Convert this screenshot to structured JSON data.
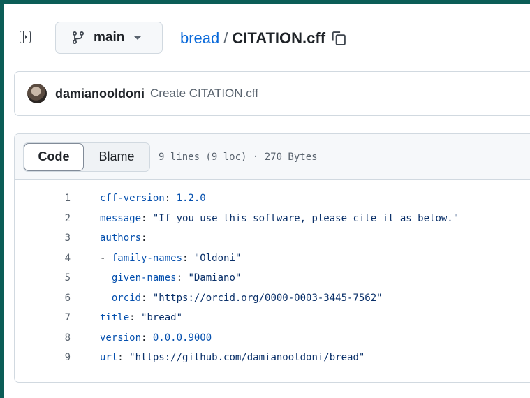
{
  "branch": {
    "label": "main"
  },
  "breadcrumb": {
    "repo": "bread",
    "separator": "/",
    "file": "CITATION.cff"
  },
  "commit": {
    "author": "damianooldoni",
    "message": "Create CITATION.cff"
  },
  "file_header": {
    "code_tab": "Code",
    "blame_tab": "Blame",
    "meta": "9 lines (9 loc) · 270 Bytes"
  },
  "lines": [
    {
      "n": "1",
      "key": "cff-version",
      "sep": ": ",
      "val": "1.2.0",
      "prefix": ""
    },
    {
      "n": "2",
      "key": "message",
      "sep": ": ",
      "val": "\"If you use this software, please cite it as below.\"",
      "prefix": ""
    },
    {
      "n": "3",
      "key": "authors",
      "sep": ":",
      "val": "",
      "prefix": ""
    },
    {
      "n": "4",
      "key": "family-names",
      "sep": ": ",
      "val": "\"Oldoni\"",
      "prefix": "- "
    },
    {
      "n": "5",
      "key": "given-names",
      "sep": ": ",
      "val": "\"Damiano\"",
      "prefix": "  "
    },
    {
      "n": "6",
      "key": "orcid",
      "sep": ": ",
      "val": "\"https://orcid.org/0000-0003-3445-7562\"",
      "prefix": "  "
    },
    {
      "n": "7",
      "key": "title",
      "sep": ": ",
      "val": "\"bread\"",
      "prefix": ""
    },
    {
      "n": "8",
      "key": "version",
      "sep": ": ",
      "val": "0.0.0.9000",
      "prefix": ""
    },
    {
      "n": "9",
      "key": "url",
      "sep": ": ",
      "val": "\"https://github.com/damianooldoni/bread\"",
      "prefix": ""
    }
  ],
  "icons": {
    "sidebar": "sidebar-expand-icon",
    "branch": "git-branch-icon",
    "caret": "triangle-down-icon",
    "copy": "copy-icon",
    "avatar": "avatar"
  },
  "colors": {
    "frame": "#0b5d57",
    "link": "#0969da",
    "yaml_key": "#0550ae",
    "yaml_string": "#0a3069"
  }
}
